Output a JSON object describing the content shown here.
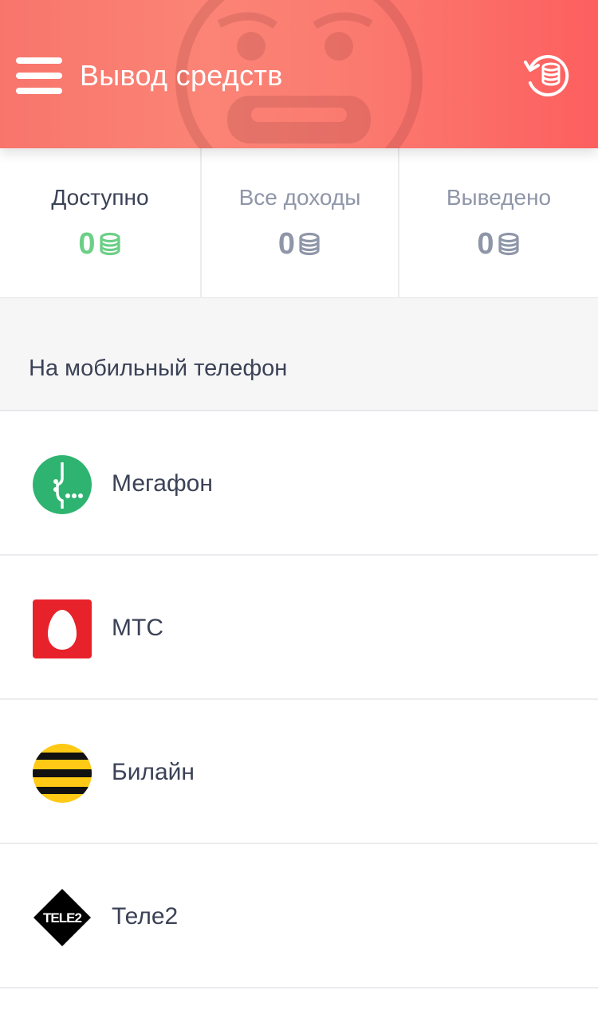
{
  "header": {
    "title": "Вывод средств",
    "menu_icon": "hamburger-menu-icon",
    "history_icon": "coins-history-icon",
    "background": "#fb7a70"
  },
  "stats": [
    {
      "label": "Доступно",
      "value": "0",
      "color": "#6ccf86"
    },
    {
      "label": "Все доходы",
      "value": "0",
      "color": "#8f96a8"
    },
    {
      "label": "Выведено",
      "value": "0",
      "color": "#8f96a8"
    }
  ],
  "section": {
    "title": "На мобильный телефон"
  },
  "operators": [
    {
      "name": "Мегафон",
      "icon": "megafon-logo-icon",
      "color": "#2eb470"
    },
    {
      "name": "МТС",
      "icon": "mts-logo-icon",
      "color": "#e8222a"
    },
    {
      "name": "Билайн",
      "icon": "beeline-logo-icon",
      "color": "#ffc915"
    },
    {
      "name": "Теле2",
      "icon": "tele2-logo-icon",
      "color": "#000000"
    }
  ]
}
